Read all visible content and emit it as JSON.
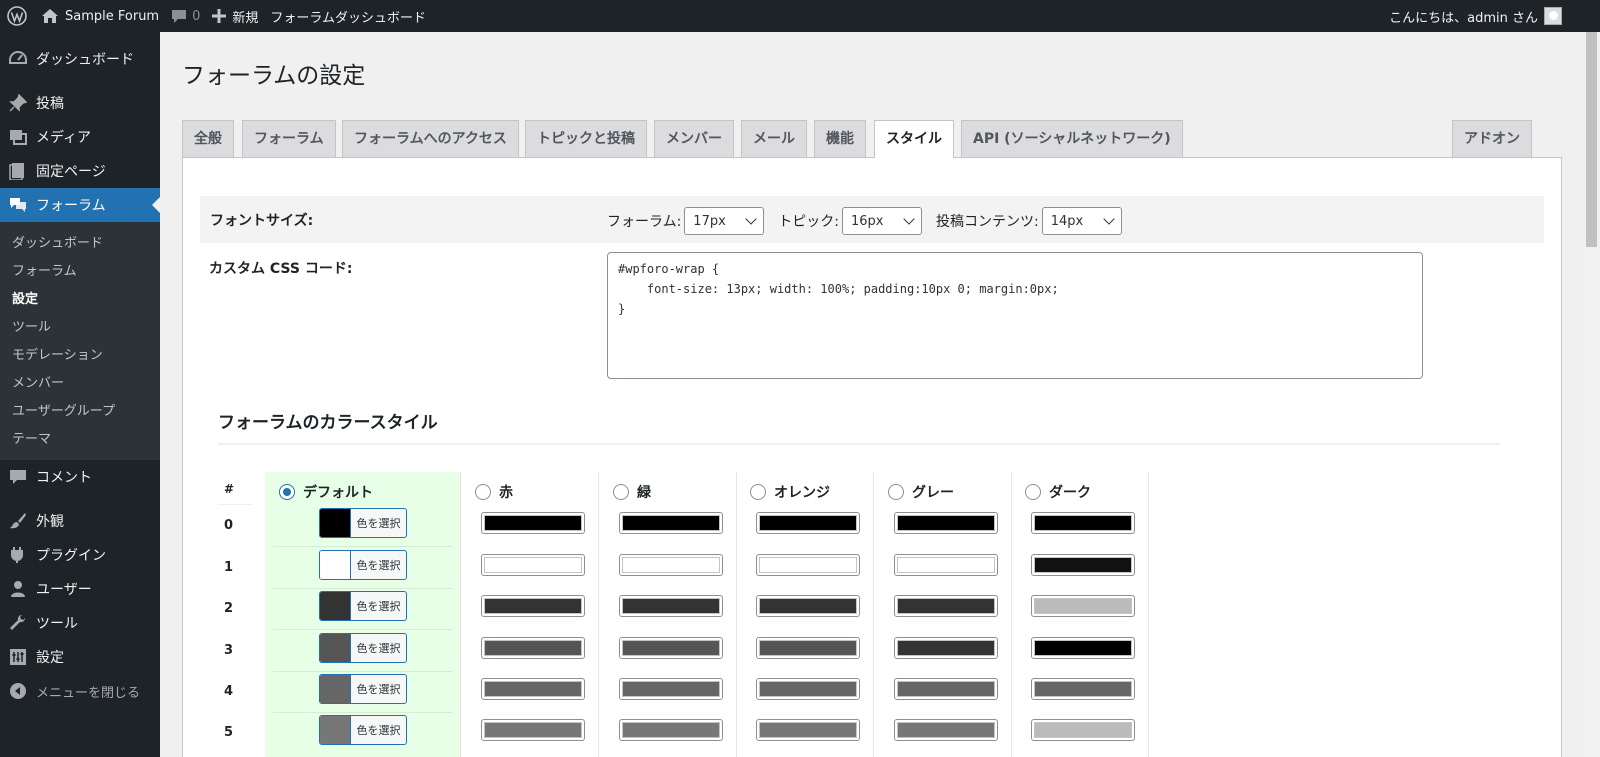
{
  "adminbar": {
    "logo_icon": "wordpress-logo-icon",
    "site_name": "Sample Forum",
    "comments_count": "0",
    "new_label": "新規",
    "dashboard_link": "フォーラムダッシュボード",
    "greeting": "こんにちは、admin さん"
  },
  "sidebar": {
    "items": [
      {
        "label": "ダッシュボード",
        "icon": "dashboard-icon"
      },
      {
        "label": "投稿",
        "icon": "pin-icon"
      },
      {
        "label": "メディア",
        "icon": "media-icon"
      },
      {
        "label": "固定ページ",
        "icon": "pages-icon"
      },
      {
        "label": "フォーラム",
        "icon": "forum-icon"
      },
      {
        "label": "コメント",
        "icon": "comment-icon"
      },
      {
        "label": "外観",
        "icon": "brush-icon"
      },
      {
        "label": "プラグイン",
        "icon": "plugin-icon"
      },
      {
        "label": "ユーザー",
        "icon": "user-icon"
      },
      {
        "label": "ツール",
        "icon": "wrench-icon"
      },
      {
        "label": "設定",
        "icon": "settings-icon"
      }
    ],
    "submenu": [
      "ダッシュボード",
      "フォーラム",
      "設定",
      "ツール",
      "モデレーション",
      "メンバー",
      "ユーザーグループ",
      "テーマ"
    ],
    "collapse_label": "メニューを閉じる"
  },
  "page": {
    "title": "フォーラムの設定",
    "tabs": [
      "全般",
      "フォーラム",
      "フォーラムへのアクセス",
      "トピックと投稿",
      "メンバー",
      "メール",
      "機能",
      "スタイル",
      "API (ソーシャルネットワーク)",
      "アドオン"
    ],
    "active_tab": "スタイル"
  },
  "font_size": {
    "label": "フォントサイズ:",
    "forum_label": "フォーラム:",
    "forum_value": "17px",
    "topic_label": "トピック:",
    "topic_value": "16px",
    "post_label": "投稿コンテンツ:",
    "post_value": "14px"
  },
  "custom_css": {
    "label": "カスタム CSS コード:",
    "lines": [
      "#wpforo-wrap {",
      "    font-size: 13px; width: 100%; padding:10px 0; margin:0px;",
      "}"
    ]
  },
  "color_styles": {
    "title": "フォーラムのカラースタイル",
    "num_header": "#",
    "rows": [
      "0",
      "1",
      "2",
      "3",
      "4",
      "5"
    ],
    "picker_label": "色を選択",
    "styles": [
      {
        "name": "デフォルト",
        "checked": true,
        "colors": [
          "#000000",
          "#ffffff",
          "#333333",
          "#555555",
          "#666666",
          "#777777"
        ]
      },
      {
        "name": "赤",
        "checked": false,
        "colors": [
          "#000000",
          "#ffffff",
          "#333333",
          "#555555",
          "#666666",
          "#777777"
        ]
      },
      {
        "name": "緑",
        "checked": false,
        "colors": [
          "#000000",
          "#ffffff",
          "#333333",
          "#555555",
          "#666666",
          "#777777"
        ]
      },
      {
        "name": "オレンジ",
        "checked": false,
        "colors": [
          "#000000",
          "#ffffff",
          "#333333",
          "#555555",
          "#666666",
          "#777777"
        ]
      },
      {
        "name": "グレー",
        "checked": false,
        "colors": [
          "#000000",
          "#ffffff",
          "#333333",
          "#333333",
          "#666666",
          "#777777"
        ]
      },
      {
        "name": "ダーク",
        "checked": false,
        "colors": [
          "#000000",
          "#111111",
          "#bbbbbb",
          "#000000",
          "#666666",
          "#bbbbbb"
        ]
      }
    ]
  },
  "colors": {
    "accent": "#2271b1",
    "adminbar_bg": "#1d2327",
    "default_col_bg": "#e6ffe6"
  }
}
